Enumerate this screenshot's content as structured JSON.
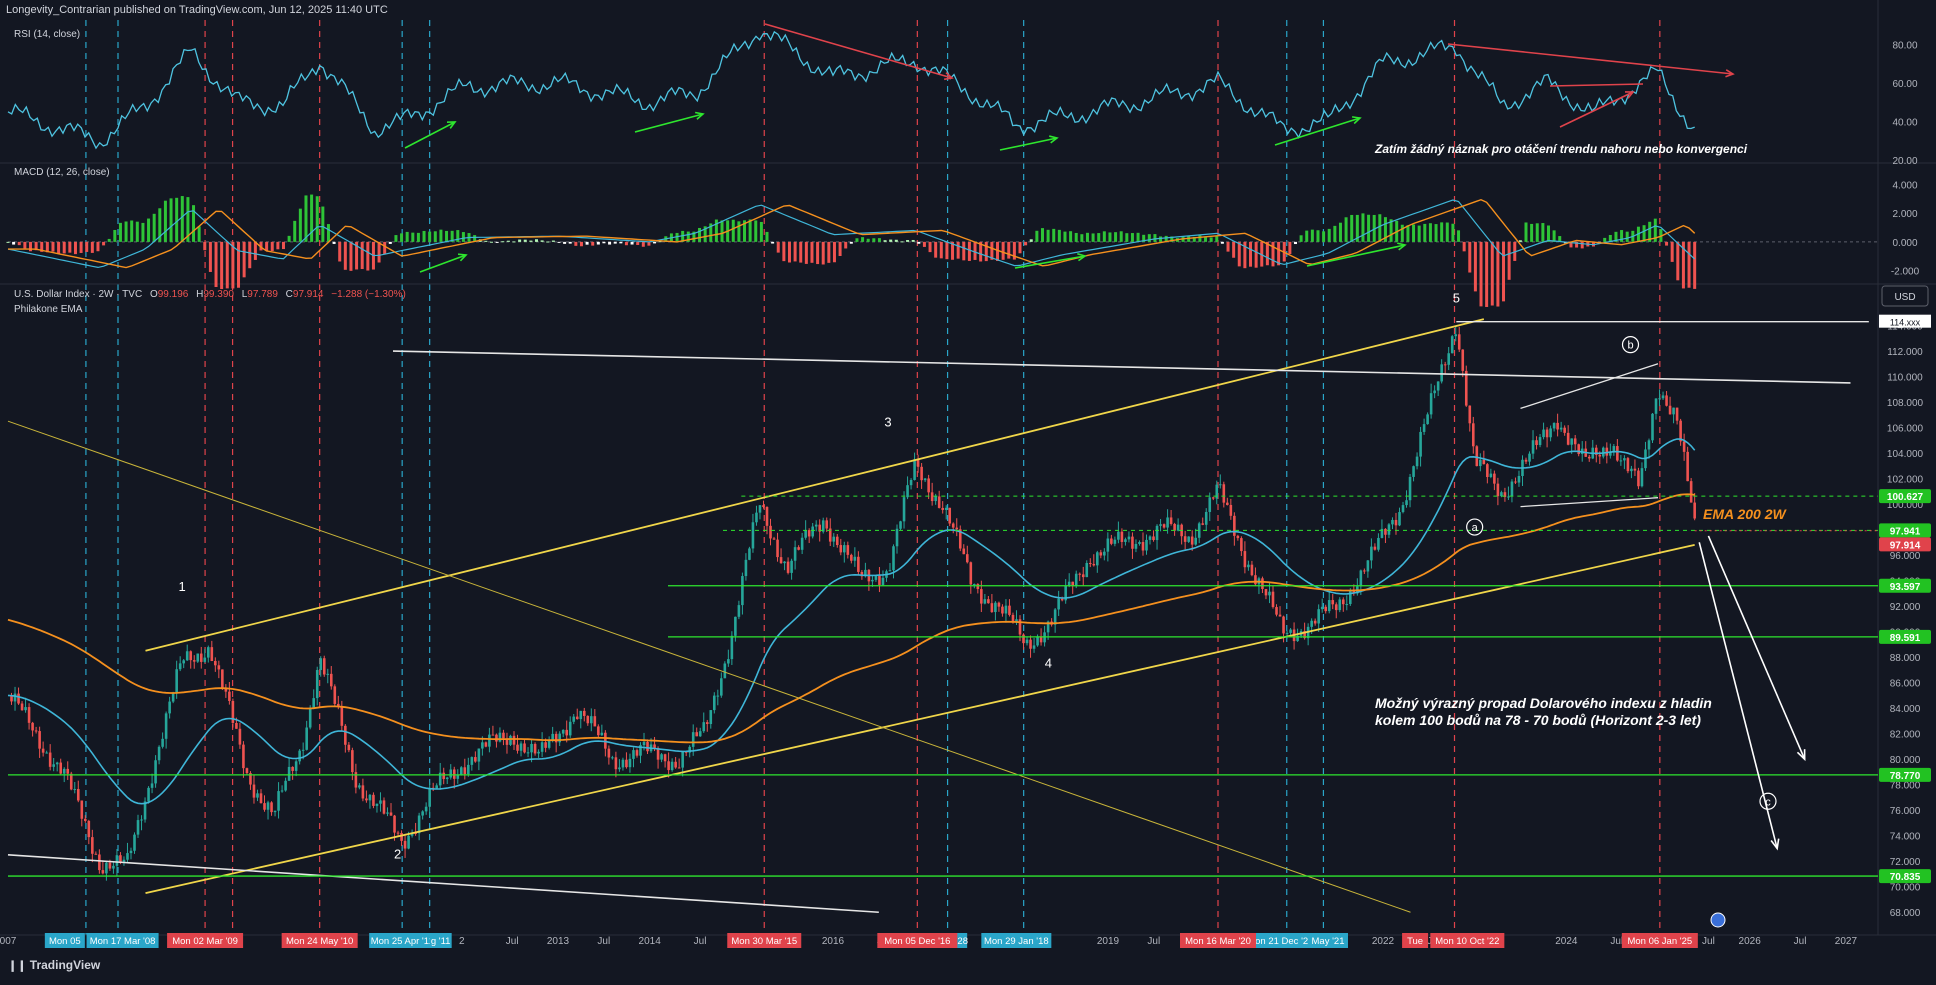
{
  "header": {
    "published": "Longevity_Contrarian published on TradingView.com, Jun 12, 2025 11:40 UTC"
  },
  "footer": {
    "brand": "TradingView"
  },
  "colors": {
    "background": "#131722",
    "rsi": "#4ec3e0",
    "ema_teal": "#3fb6d8",
    "ema_orange": "#f5901e",
    "channel_yellow": "#f0d64a",
    "support_green": "#2ee62e",
    "bull": "#26a69a",
    "bear": "#ef5350",
    "cyan_vline": "#2aa6c9",
    "red_vline": "#e0434b"
  },
  "panes": {
    "rsi": {
      "title": "RSI (14, close)",
      "ticks": [
        "80.00",
        "60.00",
        "40.00",
        "20.00"
      ],
      "note": "Zatím žádný náznak pro otáčení trendu nahoru nebo konvergenci"
    },
    "macd": {
      "title": "MACD (12, 26, close)",
      "ticks": [
        "4.000",
        "2.000",
        "0.000",
        "-2.000"
      ]
    },
    "price": {
      "symbol_line": "U.S. Dollar Index · 2W · TVC",
      "ohlc": {
        "o_label": "O",
        "o": "99.196",
        "h_label": "H",
        "h": "99.390",
        "l_label": "L",
        "l": "97.789",
        "c_label": "C",
        "c": "97.914",
        "chg": "−1.288 (−1.30%)"
      },
      "indicator": "Philakone EMA",
      "currency": "USD",
      "ticks": [
        "114.000",
        "112.000",
        "110.000",
        "108.000",
        "106.000",
        "104.000",
        "102.000",
        "100.000",
        "98.000",
        "96.000",
        "94.000",
        "92.000",
        "90.000",
        "88.000",
        "86.000",
        "84.000",
        "82.000",
        "80.000",
        "78.000",
        "76.000",
        "74.000",
        "72.000",
        "70.000",
        "68.000"
      ],
      "badges": [
        {
          "text": "100.627",
          "kind": "green"
        },
        {
          "text": "97.941",
          "kind": "green"
        },
        {
          "text": "97.914",
          "kind": "red"
        },
        {
          "text": "93.597",
          "kind": "green"
        },
        {
          "text": "89.591",
          "kind": "green"
        },
        {
          "text": "78.770",
          "kind": "green"
        },
        {
          "text": "70.835",
          "kind": "green"
        }
      ],
      "top_badge": "114.xxx",
      "ema_label": "EMA 200 2W",
      "wave_labels": [
        "1",
        "2",
        "3",
        "4",
        "5",
        "b",
        "a",
        "c"
      ],
      "annotation": [
        "Možný výrazný propad Dolarového indexu z hladin",
        "kolem 100 bodů na 78 - 70 bodů (Horizont 2-3 let)"
      ]
    }
  },
  "time_axis": {
    "labels": [
      "007",
      "2",
      "Jul",
      "2013",
      "Jul",
      "2014",
      "Jul",
      "2016",
      "Jul",
      "2019",
      "Jul",
      "2022",
      "Jul",
      "2024",
      "Jul",
      "Jul",
      "2026",
      "Jul",
      "2027"
    ],
    "cyan_badges": [
      "Mon 05",
      "Mon 17 Mar '08",
      "Mon 25 Apr '11",
      "g '11",
      "Mon 28",
      "Mon 29 Jan '18",
      "Mon 21 Dec '20",
      "May '21"
    ],
    "red_badges": [
      "Mon 02 Mar '09",
      "Mon 24 May '10",
      "Mon 30 Mar '15",
      "Mon 05 Dec '16",
      "Mon 16 Mar '20",
      "Tue",
      "Mon 10 Oct '22",
      "Mon 06 Jan '25"
    ],
    "cut_label": "20"
  },
  "chart_data": [
    {
      "type": "line",
      "title": "RSI (14, close)",
      "x": [
        2007.0,
        2008.0,
        2008.5,
        2009.0,
        2009.5,
        2010.0,
        2010.4,
        2011.0,
        2011.3,
        2012.0,
        2013.0,
        2014.0,
        2014.5,
        2015.2,
        2016.0,
        2016.9,
        2017.5,
        2018.0,
        2018.5,
        2019.5,
        2020.2,
        2020.9,
        2021.4,
        2022.0,
        2022.8,
        2023.3,
        2023.8,
        2024.3,
        2024.7,
        2025.0,
        2025.4
      ],
      "values": [
        45,
        30,
        48,
        76,
        50,
        48,
        72,
        36,
        40,
        58,
        60,
        50,
        55,
        88,
        63,
        72,
        55,
        38,
        42,
        52,
        60,
        36,
        40,
        70,
        79,
        48,
        60,
        44,
        57,
        65,
        35
      ],
      "ylim": [
        20,
        90
      ]
    },
    {
      "type": "bar",
      "title": "MACD (12, 26, close)",
      "x": [
        2007.0,
        2008.0,
        2008.5,
        2009.0,
        2009.5,
        2010.0,
        2010.4,
        2011.0,
        2011.3,
        2012.0,
        2013.0,
        2014.0,
        2014.5,
        2015.2,
        2016.0,
        2016.9,
        2017.5,
        2018.0,
        2018.5,
        2019.5,
        2020.2,
        2020.9,
        2021.4,
        2022.0,
        2022.8,
        2023.3,
        2023.8,
        2024.3,
        2024.7,
        2025.0,
        2025.4
      ],
      "values": [
        -0.5,
        -1.8,
        -0.5,
        2.3,
        -0.6,
        -1.2,
        1.2,
        -1.0,
        -0.6,
        0.3,
        0.4,
        0.0,
        0.6,
        2.6,
        0.5,
        0.8,
        -0.6,
        -1.7,
        -0.9,
        0.2,
        0.6,
        -1.6,
        -0.8,
        1.2,
        3.0,
        -1.0,
        0.1,
        -0.2,
        0.3,
        1.2,
        -1.2
      ],
      "ylim": [
        -3,
        5
      ]
    },
    {
      "type": "line",
      "title": "U.S. Dollar Index · 2W · TVC",
      "x": [
        2007.0,
        2007.3,
        2007.6,
        2008.0,
        2008.3,
        2008.6,
        2008.9,
        2009.2,
        2009.6,
        2009.9,
        2010.2,
        2010.4,
        2010.8,
        2011.1,
        2011.3,
        2011.6,
        2012.0,
        2012.5,
        2012.8,
        2013.2,
        2013.6,
        2013.9,
        2014.3,
        2014.6,
        2014.9,
        2015.2,
        2015.5,
        2015.9,
        2016.3,
        2016.6,
        2016.9,
        2017.2,
        2017.5,
        2017.8,
        2018.1,
        2018.4,
        2018.8,
        2019.2,
        2019.6,
        2019.9,
        2020.2,
        2020.5,
        2020.9,
        2021.2,
        2021.5,
        2021.9,
        2022.2,
        2022.5,
        2022.8,
        2023.0,
        2023.3,
        2023.6,
        2023.9,
        2024.2,
        2024.5,
        2024.8,
        2025.0,
        2025.2,
        2025.4
      ],
      "values": [
        85.0,
        82.0,
        79.0,
        72.0,
        71.5,
        80.0,
        87.5,
        89.0,
        79.0,
        75.5,
        81.0,
        88.0,
        78.5,
        75.5,
        73.5,
        77.0,
        80.0,
        82.0,
        80.0,
        84.0,
        80.0,
        80.5,
        80.0,
        82.0,
        90.0,
        100.0,
        95.0,
        99.0,
        94.0,
        95.0,
        103.0,
        100.0,
        94.0,
        92.0,
        89.0,
        91.0,
        96.0,
        97.0,
        98.0,
        97.5,
        101.0,
        96.0,
        90.0,
        90.5,
        92.0,
        96.0,
        100.0,
        107.0,
        114.5,
        103.0,
        101.0,
        103.5,
        107.0,
        103.0,
        105.0,
        101.0,
        109.5,
        107.0,
        97.9
      ],
      "ylim": [
        67,
        116
      ]
    }
  ]
}
